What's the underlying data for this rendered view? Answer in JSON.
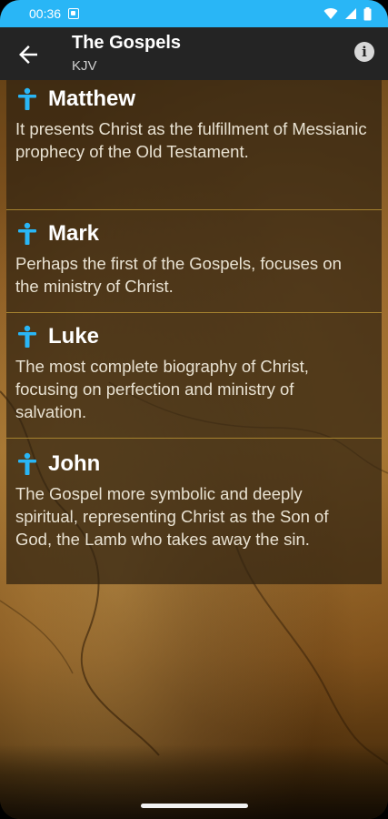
{
  "status_bar": {
    "time": "00:36",
    "icons": [
      "notification-badge-icon",
      "wifi-icon",
      "signal-icon",
      "battery-icon"
    ]
  },
  "app_bar": {
    "title": "The Gospels",
    "subtitle": "KJV",
    "back_icon": "arrow-back-icon",
    "info_icon": "info-icon"
  },
  "colors": {
    "status_bar": "#29b6f6",
    "app_bar": "#242424",
    "icon_accent": "#29b6f6",
    "divider": "#a5822f"
  },
  "gospels": [
    {
      "name": "Matthew",
      "description": "It presents Christ as the fulfillment of Messianic prophecy of the Old Testament."
    },
    {
      "name": "Mark",
      "description": "Perhaps the first of the Gospels, focuses on the ministry of Christ."
    },
    {
      "name": "Luke",
      "description": "The most complete biography of Christ, focusing on perfection and ministry of salvation."
    },
    {
      "name": "John",
      "description": "The Gospel more symbolic and deeply spiritual, representing Christ as the Son of God, the Lamb who takes away the sin."
    }
  ]
}
